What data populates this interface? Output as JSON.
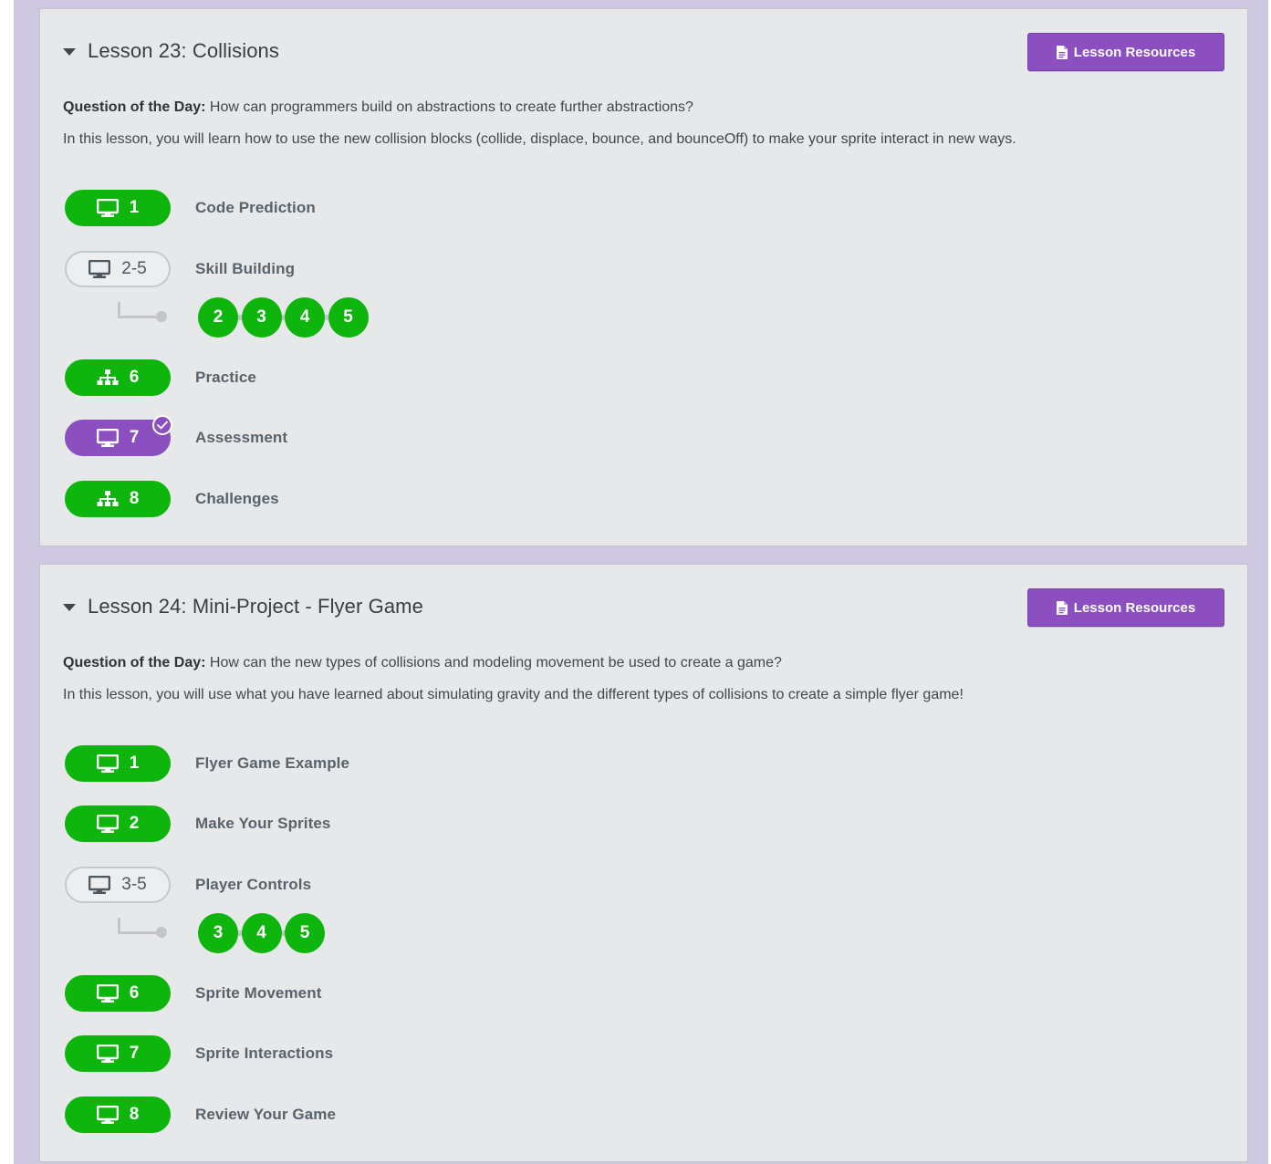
{
  "colors": {
    "page_bg": "#cdc7e0",
    "card_bg": "#e7e8ea",
    "green": "#0db50d",
    "purple": "#8b4fbf",
    "outline_border": "#c5c8cc"
  },
  "lessons": [
    {
      "title": "Lesson 23: Collisions",
      "resources_label": "Lesson Resources",
      "qotd_label": "Question of the Day:",
      "qotd_text": "How can programmers build on abstractions to create further abstractions?",
      "overview": "In this lesson, you will learn how to use the new collision blocks (collide, displace, bounce, and bounceOff) to make your sprite interact in new ways.",
      "levels": [
        {
          "label": "1",
          "name": "Code Prediction",
          "style": "green",
          "icon": "desktop-icon"
        },
        {
          "label": "2-5",
          "name": "Skill Building",
          "style": "outline",
          "icon": "desktop-icon"
        },
        {
          "label": "6",
          "name": "Practice",
          "style": "green",
          "icon": "sitemap-icon"
        },
        {
          "label": "7",
          "name": "Assessment",
          "style": "purple",
          "icon": "desktop-icon",
          "assessment": true
        },
        {
          "label": "8",
          "name": "Challenges",
          "style": "green",
          "icon": "sitemap-icon"
        }
      ],
      "sublevels": [
        "2",
        "3",
        "4",
        "5"
      ]
    },
    {
      "title": "Lesson 24: Mini-Project - Flyer Game",
      "resources_label": "Lesson Resources",
      "qotd_label": "Question of the Day:",
      "qotd_text": "How can the new types of collisions and modeling movement be used to create a game?",
      "overview": "In this lesson, you will use what you have learned about simulating gravity and the different types of collisions to create a simple flyer game!",
      "levels": [
        {
          "label": "1",
          "name": "Flyer Game Example",
          "style": "green",
          "icon": "desktop-icon"
        },
        {
          "label": "2",
          "name": "Make Your Sprites",
          "style": "green",
          "icon": "desktop-icon"
        },
        {
          "label": "3-5",
          "name": "Player Controls",
          "style": "outline",
          "icon": "desktop-icon"
        },
        {
          "label": "6",
          "name": "Sprite Movement",
          "style": "green",
          "icon": "desktop-icon"
        },
        {
          "label": "7",
          "name": "Sprite Interactions",
          "style": "green",
          "icon": "desktop-icon"
        },
        {
          "label": "8",
          "name": "Review Your Game",
          "style": "green",
          "icon": "desktop-icon"
        }
      ],
      "sublevels": [
        "3",
        "4",
        "5"
      ]
    }
  ]
}
